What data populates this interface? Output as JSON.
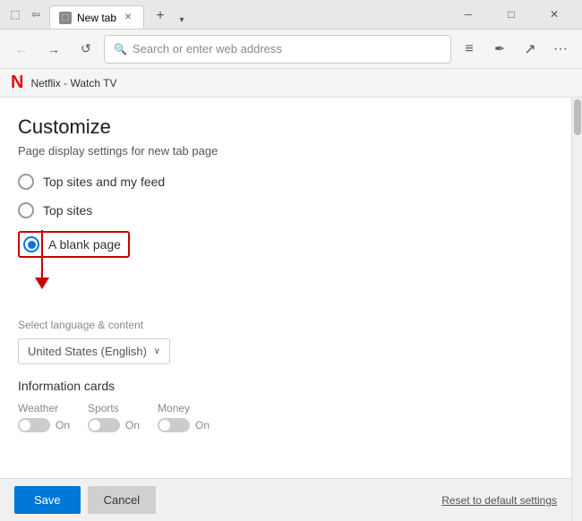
{
  "titlebar": {
    "tab_label": "New tab",
    "tab_favicon": "⬜",
    "close_icon": "✕",
    "new_tab_icon": "+",
    "dropdown_icon": "▾",
    "minimize_icon": "─",
    "maximize_icon": "□",
    "window_close_icon": "✕"
  },
  "navbar": {
    "back_icon": "←",
    "forward_icon": "→",
    "refresh_icon": "↺",
    "search_placeholder": "Search or enter web address",
    "menu_icon": "≡",
    "favorites_icon": "✒",
    "share_icon": "↗",
    "more_icon": "···"
  },
  "netflix_bar": {
    "logo": "N",
    "title": "Netflix - Watch TV"
  },
  "customize": {
    "title": "Customize",
    "subtitle": "Page display settings for new tab page",
    "options": [
      {
        "id": "top-sites-feed",
        "label": "Top sites and my feed",
        "selected": false
      },
      {
        "id": "top-sites",
        "label": "Top sites",
        "selected": false
      },
      {
        "id": "blank-page",
        "label": "A blank page",
        "selected": true
      }
    ]
  },
  "language": {
    "section_label": "Select language & content",
    "selected_value": "United States (English)",
    "dropdown_arrow": "∨"
  },
  "info_cards": {
    "title": "Information cards",
    "cards": [
      {
        "name": "Weather",
        "toggle_label": "On"
      },
      {
        "name": "Sports",
        "toggle_label": "On"
      },
      {
        "name": "Money",
        "toggle_label": "On"
      }
    ]
  },
  "footer": {
    "save_label": "Save",
    "cancel_label": "Cancel",
    "reset_label": "Reset to default settings"
  }
}
